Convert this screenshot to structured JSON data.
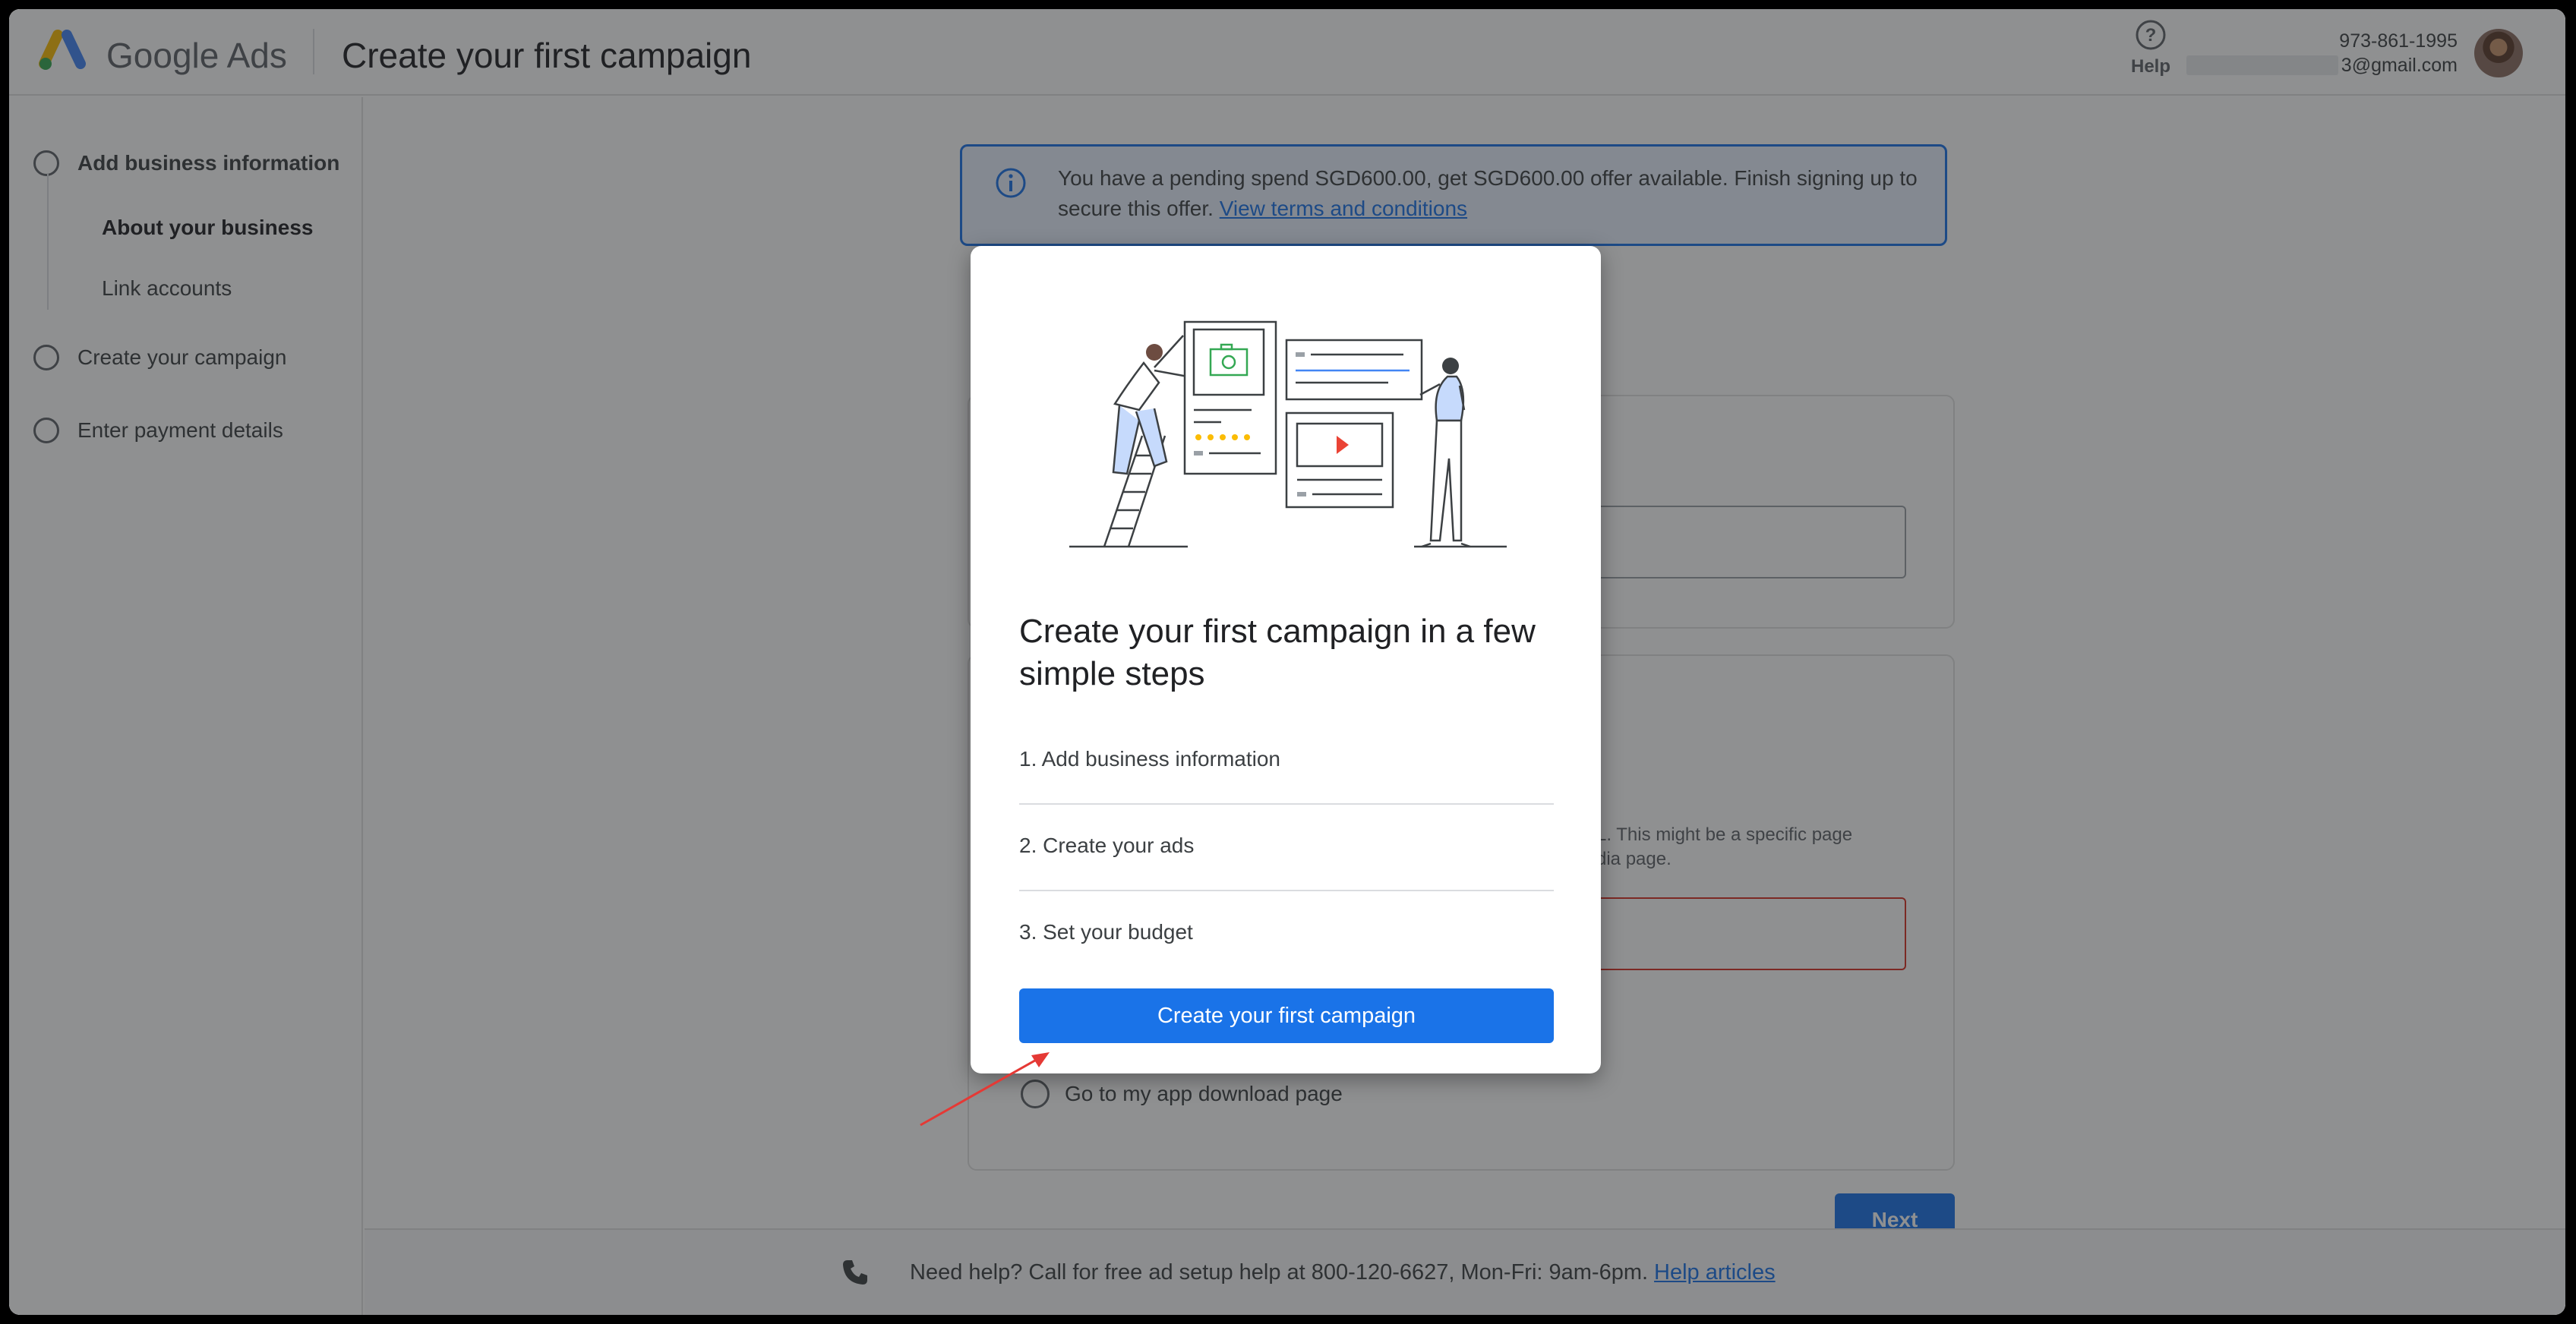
{
  "header": {
    "brand": "Google Ads",
    "page_title": "Create your first campaign",
    "help_label": "Help",
    "account_phone": "973-861-1995",
    "account_email": "3@gmail.com"
  },
  "sidebar": {
    "items": [
      {
        "label": "Add business information",
        "bold": true
      },
      {
        "label": "About your business",
        "bold": true,
        "sub": true
      },
      {
        "label": "Link accounts",
        "sub": true
      },
      {
        "label": "Create your campaign"
      },
      {
        "label": "Enter payment details"
      }
    ]
  },
  "banner": {
    "text": "You have a pending spend SGD600.00, get SGD600.00 offer available. Finish signing up to secure this offer.",
    "link": "View terms and conditions"
  },
  "background": {
    "partial_hint_line1": "L. This might be a specific page",
    "partial_hint_line2": "dia page.",
    "radio_label": "Go to my app download page",
    "next_label": "Next"
  },
  "footer": {
    "text": "Need help? Call for free ad setup help at 800-120-6627, Mon-Fri: 9am-6pm.",
    "link": "Help articles"
  },
  "modal": {
    "title": "Create your first campaign in a few simple steps",
    "steps": [
      "1. Add business information",
      "2. Create your ads",
      "3. Set your budget"
    ],
    "cta_label": "Create your first campaign"
  },
  "colors": {
    "primary": "#1a73e8",
    "overlay": "rgba(32,33,36,0.5)",
    "annotation": "#e53935"
  }
}
